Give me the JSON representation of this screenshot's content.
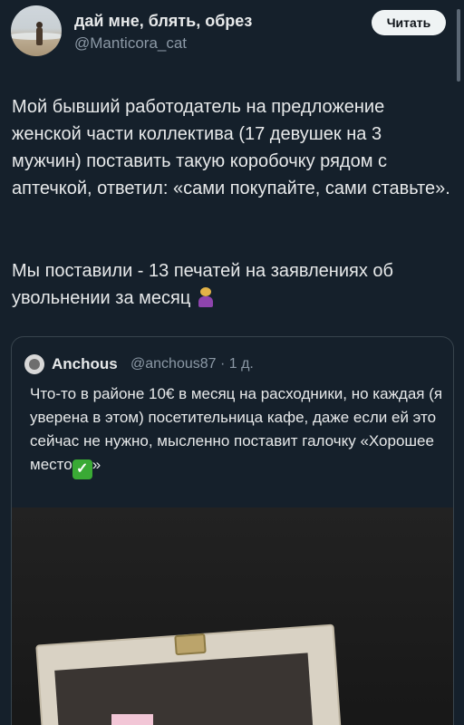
{
  "author": {
    "display_name": "дай мне, блять, обрез",
    "handle": "@Manticora_cat"
  },
  "follow_button": {
    "label": "Читать"
  },
  "tweet": {
    "paragraph1": "Мой бывший работодатель на предложение женской части коллектива (17 девушек на 3 мужчин) поставить такую коробочку рядом с аптечкой, ответил: «сами покупайте, сами ставьте».",
    "paragraph2": "Мы поставили - 13 печатей на заявлениях об увольнении за месяц",
    "paragraph2_emoji": "woman-shrugging-icon"
  },
  "quote": {
    "name": "Anchous",
    "handle_time": "@anchous87 · 1 д.",
    "text": "Что-то в районе 10€ в месяц на расходники, но каждая (я уверена в этом) посетительница кафе, даже если ей это сейчас не нужно, мысленно поставит галочку «Хорошее место",
    "text_end": "»",
    "check_emoji": "✓"
  },
  "colors": {
    "background": "#15202b",
    "text": "#e7e9ea",
    "secondary": "#8b98a5",
    "border": "#38444d",
    "button_bg": "#eff3f4"
  }
}
